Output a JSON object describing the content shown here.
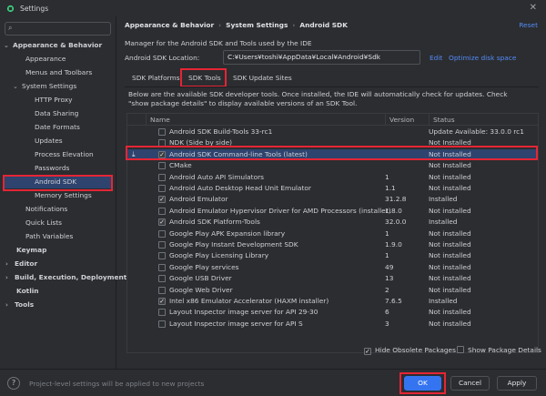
{
  "window": {
    "title": "Settings"
  },
  "sidebar": {
    "items": [
      {
        "label": "Appearance & Behavior",
        "arrow": "⌄"
      },
      {
        "label": "Appearance"
      },
      {
        "label": "Menus and Toolbars"
      },
      {
        "label": "System Settings",
        "arrow": "⌄"
      },
      {
        "label": "HTTP Proxy"
      },
      {
        "label": "Data Sharing"
      },
      {
        "label": "Date Formats"
      },
      {
        "label": "Updates"
      },
      {
        "label": "Process Elevation"
      },
      {
        "label": "Passwords"
      },
      {
        "label": "Android SDK"
      },
      {
        "label": "Memory Settings"
      },
      {
        "label": "Notifications"
      },
      {
        "label": "Quick Lists"
      },
      {
        "label": "Path Variables"
      },
      {
        "label": "Keymap"
      },
      {
        "label": "Editor",
        "arrow": "›"
      },
      {
        "label": "Build, Execution, Deployment",
        "arrow": "›"
      },
      {
        "label": "Kotlin"
      },
      {
        "label": "Tools",
        "arrow": "›"
      }
    ]
  },
  "header": {
    "crumbs": [
      "Appearance & Behavior",
      "System Settings",
      "Android SDK"
    ],
    "separator": "›",
    "reset": "Reset"
  },
  "main": {
    "description": "Manager for the Android SDK and Tools used by the IDE",
    "location_label": "Android SDK Location:",
    "location_value": "C:¥Users¥toshi¥AppData¥Local¥Android¥Sdk",
    "edit": "Edit",
    "optimize": "Optimize disk space",
    "tabs": [
      "SDK Platforms",
      "SDK Tools",
      "SDK Update Sites"
    ],
    "note_line1": "Below are the available SDK developer tools. Once installed, the IDE will automatically check for updates. Check",
    "note_line2": "\"show package details\" to display available versions of an SDK Tool.",
    "columns": [
      "Name",
      "Version",
      "Status"
    ],
    "rows": [
      {
        "name": "Android SDK Build-Tools 33-rc1",
        "version": "",
        "status": "Update Available: 33.0.0 rc1",
        "checked": false
      },
      {
        "name": "NDK (Side by side)",
        "version": "",
        "status": "Not Installed",
        "checked": false
      },
      {
        "name": "Android SDK Command-line Tools (latest)",
        "version": "",
        "status": "Not Installed",
        "checked": true
      },
      {
        "name": "CMake",
        "version": "",
        "status": "Not Installed",
        "checked": false
      },
      {
        "name": "Android Auto API Simulators",
        "version": "1",
        "status": "Not installed",
        "checked": false
      },
      {
        "name": "Android Auto Desktop Head Unit Emulator",
        "version": "1.1",
        "status": "Not installed",
        "checked": false
      },
      {
        "name": "Android Emulator",
        "version": "31.2.8",
        "status": "Installed",
        "checked": true
      },
      {
        "name": "Android Emulator Hypervisor Driver for AMD Processors (installer)",
        "version": "1.8.0",
        "status": "Not installed",
        "checked": false
      },
      {
        "name": "Android SDK Platform-Tools",
        "version": "32.0.0",
        "status": "Installed",
        "checked": true
      },
      {
        "name": "Google Play APK Expansion library",
        "version": "1",
        "status": "Not installed",
        "checked": false
      },
      {
        "name": "Google Play Instant Development SDK",
        "version": "1.9.0",
        "status": "Not installed",
        "checked": false
      },
      {
        "name": "Google Play Licensing Library",
        "version": "1",
        "status": "Not installed",
        "checked": false
      },
      {
        "name": "Google Play services",
        "version": "49",
        "status": "Not installed",
        "checked": false
      },
      {
        "name": "Google USB Driver",
        "version": "13",
        "status": "Not installed",
        "checked": false
      },
      {
        "name": "Google Web Driver",
        "version": "2",
        "status": "Not installed",
        "checked": false
      },
      {
        "name": "Intel x86 Emulator Accelerator (HAXM installer)",
        "version": "7.6.5",
        "status": "Installed",
        "checked": true
      },
      {
        "name": "Layout Inspector image server for API 29-30",
        "version": "6",
        "status": "Not installed",
        "checked": false
      },
      {
        "name": "Layout Inspector image server for API S",
        "version": "3",
        "status": "Not installed",
        "checked": false
      }
    ],
    "hide_obsolete": "Hide Obsolete Packages",
    "show_details": "Show Package Details"
  },
  "footer": {
    "help": "?",
    "text": "Project-level settings will be applied to new projects",
    "ok": "OK",
    "cancel": "Cancel",
    "apply": "Apply"
  },
  "icons": {
    "close": "✕",
    "search": "⌕",
    "download": "⤓",
    "check": "✓"
  },
  "colors": {
    "accent": "#3574f0",
    "selection": "#2e436e",
    "highlight_box": "#e52535",
    "link": "#548af7"
  }
}
